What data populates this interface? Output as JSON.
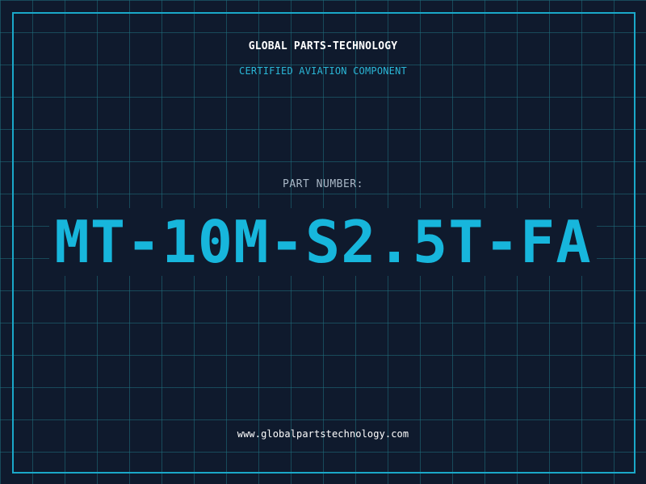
{
  "header": {
    "company_name": "GLOBAL PARTS-TECHNOLOGY",
    "subtitle": "CERTIFIED AVIATION COMPONENT"
  },
  "part": {
    "label": "PART NUMBER:",
    "number": "MT-10M-S2.5T-FA"
  },
  "footer": {
    "website": "www.globalpartstechnology.com"
  },
  "colors": {
    "background": "#0f1a2d",
    "grid": "#207080",
    "frame": "#1aa8c9",
    "accent": "#17b6dc",
    "label": "#a9b7c6",
    "text": "#ffffff"
  }
}
